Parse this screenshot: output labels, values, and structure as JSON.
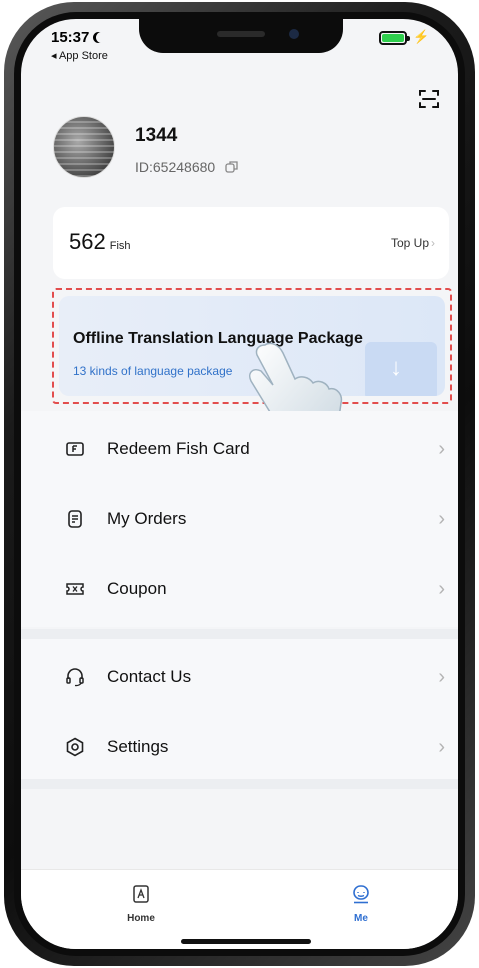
{
  "status_bar": {
    "time": "15:37",
    "back_app": "◂ App Store"
  },
  "profile": {
    "username": "1344",
    "user_id": "ID:65248680"
  },
  "wallet": {
    "amount": "562",
    "unit": "Fish",
    "top_up_label": "Top Up"
  },
  "offline_package": {
    "title": "Offline Translation Language Package",
    "subtitle": "13 kinds of language package"
  },
  "menu": {
    "group1": [
      {
        "label": "Redeem Fish Card",
        "icon": "card-icon"
      },
      {
        "label": "My Orders",
        "icon": "orders-icon"
      },
      {
        "label": "Coupon",
        "icon": "coupon-icon"
      }
    ],
    "group2": [
      {
        "label": "Contact Us",
        "icon": "headset-icon"
      },
      {
        "label": "Settings",
        "icon": "settings-icon"
      }
    ]
  },
  "tabbar": {
    "home_label": "Home",
    "me_label": "Me",
    "active": "Me"
  },
  "colors": {
    "accent": "#2f6fd1",
    "highlight_dash": "#e24d4d",
    "subtitle_link": "#3172c9"
  }
}
